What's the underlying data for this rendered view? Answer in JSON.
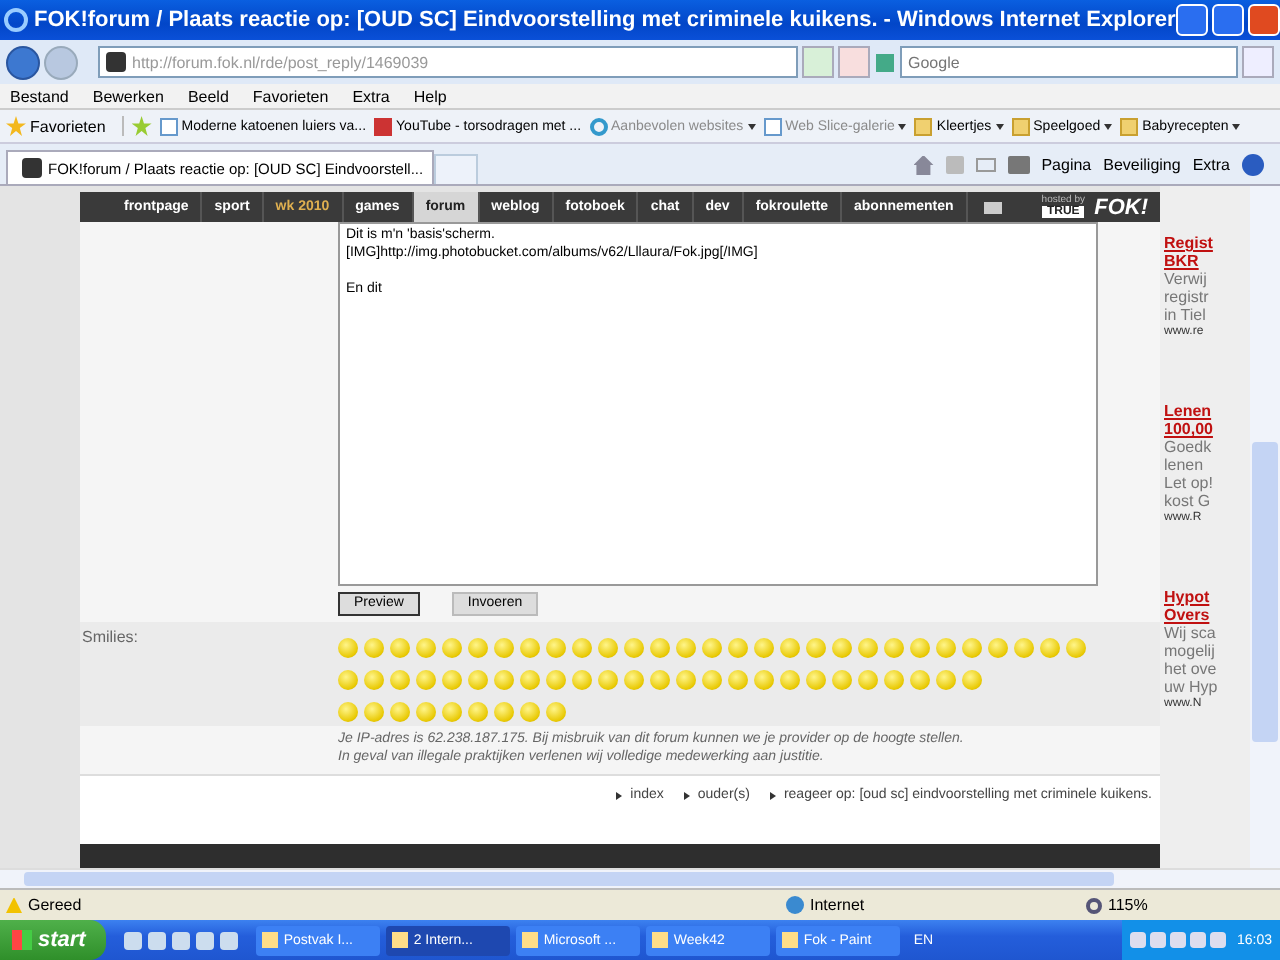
{
  "window": {
    "title": "FOK!forum / Plaats reactie op: [OUD SC] Eindvoorstelling met criminele kuikens. - Windows Internet Explorer"
  },
  "address_bar": {
    "url": "http://forum.fok.nl/rde/post_reply/1469039",
    "search_placeholder": "Google"
  },
  "menu": [
    "Bestand",
    "Bewerken",
    "Beeld",
    "Favorieten",
    "Extra",
    "Help"
  ],
  "favorites_bar": {
    "label": "Favorieten",
    "items": [
      {
        "label": "Moderne katoenen luiers va...",
        "kind": "page",
        "disabled": false,
        "dropdown": false
      },
      {
        "label": "YouTube - torsodragen met ...",
        "kind": "video",
        "disabled": false,
        "dropdown": false
      },
      {
        "label": "Aanbevolen websites",
        "kind": "ie",
        "disabled": true,
        "dropdown": true
      },
      {
        "label": "Web Slice-galerie",
        "kind": "page",
        "disabled": true,
        "dropdown": true
      },
      {
        "label": "Kleertjes",
        "kind": "folder",
        "disabled": false,
        "dropdown": true
      },
      {
        "label": "Speelgoed",
        "kind": "folder",
        "disabled": false,
        "dropdown": true
      },
      {
        "label": "Babyrecepten",
        "kind": "folder",
        "disabled": false,
        "dropdown": true
      }
    ]
  },
  "tabs": [
    {
      "label": "FOK!forum / Plaats reactie op: [OUD SC] Eindvoorstell...",
      "selected": true
    }
  ],
  "command_bar": [
    "Pagina",
    "Beveiliging",
    "Extra"
  ],
  "site_nav": {
    "items": [
      {
        "label": "frontpage",
        "selected": false,
        "highlight": false
      },
      {
        "label": "sport",
        "selected": false,
        "highlight": false
      },
      {
        "label": "wk 2010",
        "selected": false,
        "highlight": true
      },
      {
        "label": "games",
        "selected": false,
        "highlight": false
      },
      {
        "label": "forum",
        "selected": true,
        "highlight": false
      },
      {
        "label": "weblog",
        "selected": false,
        "highlight": false
      },
      {
        "label": "fotoboek",
        "selected": false,
        "highlight": false
      },
      {
        "label": "chat",
        "selected": false,
        "highlight": false
      },
      {
        "label": "dev",
        "selected": false,
        "highlight": false
      },
      {
        "label": "fokroulette",
        "selected": false,
        "highlight": false
      },
      {
        "label": "abonnementen",
        "selected": false,
        "highlight": false
      }
    ],
    "hosted_by": "hosted by",
    "host": "TRUE",
    "logo": "FOK!"
  },
  "editor": {
    "paragraphs": [
      [
        "Dit is m'n 'basis'scherm.",
        "[IMG]http://img.photobucket.com/albums/v62/Lllaura/Fok.jpg[/IMG]"
      ],
      [
        "En dit"
      ]
    ]
  },
  "buttons": [
    {
      "label": "Preview",
      "selected": true
    },
    {
      "label": "Invoeren",
      "selected": false
    }
  ],
  "smilies": {
    "label": "Smilies:"
  },
  "notice": [
    "Je IP-adres is 62.238.187.175. Bij misbruik van dit forum kunnen we je provider op de hoogte stellen.",
    "In geval van illegale praktijken verlenen wij volledige medewerking aan justitie."
  ],
  "links": [
    "index",
    "ouder(s)",
    "reageer op: [oud sc] eindvoorstelling met criminele kuikens."
  ],
  "ads": [
    {
      "title": [
        "Regist",
        "BKR"
      ],
      "body": [
        "Verwij",
        "registr",
        "in Tiel"
      ],
      "url": "www.re"
    },
    {
      "title": [
        "Lenen",
        "100,00"
      ],
      "body": [
        "Goedk",
        "lenen",
        "Let op!",
        "kost G"
      ],
      "url": "www.R"
    },
    {
      "title": [
        "Hypot",
        "Overs"
      ],
      "body": [
        "Wij sca",
        "mogelij",
        "het ove",
        "uw Hyp"
      ],
      "url": "www.N"
    }
  ],
  "status_bar": {
    "text": "Gereed",
    "zone": "Internet",
    "zoom": "115%"
  },
  "taskbar": {
    "start": "start",
    "tasks": [
      {
        "label": "Postvak I...",
        "selected": false
      },
      {
        "label": "2 Intern...",
        "selected": true
      },
      {
        "label": "Microsoft ...",
        "selected": false
      },
      {
        "label": "Week42",
        "selected": false
      },
      {
        "label": "Fok - Paint",
        "selected": false
      }
    ],
    "language": "EN",
    "clock": "16:03"
  }
}
